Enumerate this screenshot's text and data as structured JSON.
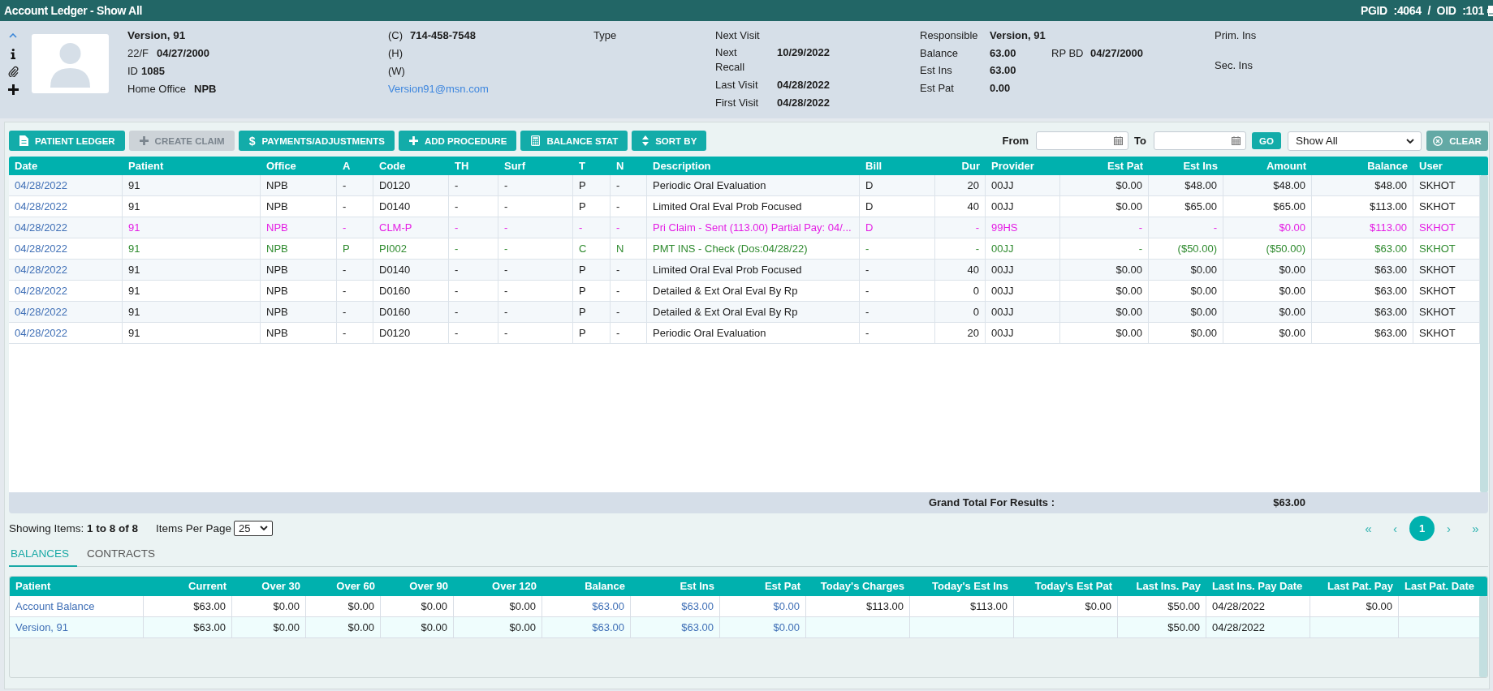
{
  "window": {
    "title": "Account Ledger - Show All",
    "ids": "PGID :4064 / OID :101"
  },
  "patient": {
    "name": "Version, 91",
    "age_sex": "22/F",
    "dob": "04/27/2000",
    "id_label": "ID",
    "id": "1085",
    "office_label": "Home Office",
    "office": "NPB"
  },
  "contact": {
    "phones": [
      {
        "label": "(C)",
        "value": "714-458-7548"
      },
      {
        "label": "(H)"
      },
      {
        "label": "(W)"
      }
    ],
    "email": "Version91@msn.com"
  },
  "type": {
    "label": "Type"
  },
  "visits": [
    {
      "label": "Next Visit"
    },
    {
      "label": "Next Recall",
      "value": "10/29/2022"
    },
    {
      "label": "Last Visit",
      "value": "04/28/2022"
    },
    {
      "label": "First Visit",
      "value": "04/28/2022"
    }
  ],
  "account": {
    "rows": [
      {
        "label": "Responsible",
        "value": "Version, 91"
      },
      {
        "label": "Balance",
        "value": "63.00"
      },
      {
        "label": "Est Ins",
        "value": "63.00"
      },
      {
        "label": "Est Pat",
        "value": "0.00"
      }
    ],
    "rp_bd": {
      "label": "RP BD",
      "value": "04/27/2000"
    }
  },
  "insurance": [
    {
      "label": "Prim. Ins"
    },
    {
      "label": "Sec. Ins"
    }
  ],
  "toolbar": {
    "buttons": [
      {
        "label": "PATIENT LEDGER",
        "disabled": false
      },
      {
        "label": "CREATE CLAIM",
        "disabled": true
      },
      {
        "label": "PAYMENTS/ADJUSTMENTS",
        "glyph": "$",
        "disabled": false
      },
      {
        "label": "ADD PROCEDURE",
        "disabled": false
      },
      {
        "label": "BALANCE STAT",
        "disabled": false
      },
      {
        "label": "SORT BY",
        "disabled": false
      }
    ],
    "filter": {
      "from_label": "From",
      "to_label": "To",
      "go": "GO",
      "view": "Show All",
      "clear": "CLEAR"
    }
  },
  "ledger": {
    "columns": [
      "Date",
      "Patient",
      "Office",
      "A",
      "Code",
      "TH",
      "Surf",
      "T",
      "N",
      "Description",
      "Bill",
      "Dur",
      "Provider",
      "Est Pat",
      "Est Ins",
      "Amount",
      "Balance",
      "User"
    ],
    "rows": [
      {
        "kind": "procedure",
        "cells": [
          "04/28/2022",
          "91",
          "NPB",
          "-",
          "D0120",
          "-",
          "-",
          "P",
          "-",
          "Periodic Oral Evaluation",
          "D",
          "20",
          "00JJ",
          "$0.00",
          "$48.00",
          "$48.00",
          "$48.00",
          "SKHOT"
        ]
      },
      {
        "kind": "procedure",
        "cells": [
          "04/28/2022",
          "91",
          "NPB",
          "-",
          "D0140",
          "-",
          "-",
          "P",
          "-",
          "Limited Oral Eval Prob Focused",
          "D",
          "40",
          "00JJ",
          "$0.00",
          "$65.00",
          "$65.00",
          "$113.00",
          "SKHOT"
        ]
      },
      {
        "kind": "claim",
        "cells": [
          "04/28/2022",
          "91",
          "NPB",
          "-",
          "CLM-P",
          "-",
          "-",
          "-",
          "-",
          "Pri Claim - Sent (113.00) Partial Pay: 04/...",
          "D",
          "-",
          "99HS",
          "-",
          "-",
          "$0.00",
          "$113.00",
          "SKHOT"
        ]
      },
      {
        "kind": "payment",
        "cells": [
          "04/28/2022",
          "91",
          "NPB",
          "P",
          "PI002",
          "-",
          "-",
          "C",
          "N",
          "PMT INS - Check (Dos:04/28/22)",
          "-",
          "-",
          "00JJ",
          "-",
          "($50.00)",
          "($50.00)",
          "$63.00",
          "SKHOT"
        ]
      },
      {
        "kind": "procedure",
        "cells": [
          "04/28/2022",
          "91",
          "NPB",
          "-",
          "D0140",
          "-",
          "-",
          "P",
          "-",
          "Limited Oral Eval Prob Focused",
          "-",
          "40",
          "00JJ",
          "$0.00",
          "$0.00",
          "$0.00",
          "$63.00",
          "SKHOT"
        ]
      },
      {
        "kind": "procedure",
        "cells": [
          "04/28/2022",
          "91",
          "NPB",
          "-",
          "D0160",
          "-",
          "-",
          "P",
          "-",
          "Detailed & Ext Oral Eval By Rp",
          "-",
          "0",
          "00JJ",
          "$0.00",
          "$0.00",
          "$0.00",
          "$63.00",
          "SKHOT"
        ]
      },
      {
        "kind": "procedure",
        "cells": [
          "04/28/2022",
          "91",
          "NPB",
          "-",
          "D0160",
          "-",
          "-",
          "P",
          "-",
          "Detailed & Ext Oral Eval By Rp",
          "-",
          "0",
          "00JJ",
          "$0.00",
          "$0.00",
          "$0.00",
          "$63.00",
          "SKHOT"
        ]
      },
      {
        "kind": "procedure",
        "cells": [
          "04/28/2022",
          "91",
          "NPB",
          "-",
          "D0120",
          "-",
          "-",
          "P",
          "-",
          "Periodic Oral Evaluation",
          "-",
          "20",
          "00JJ",
          "$0.00",
          "$0.00",
          "$0.00",
          "$63.00",
          "SKHOT"
        ]
      }
    ],
    "grand_total_label": "Grand Total For Results :",
    "grand_total": "$63.00"
  },
  "paging": {
    "showing": "Showing Items: **1 to 8 of 8**",
    "per_page_label": "Items Per Page",
    "per_page": "25",
    "first": "«",
    "prev": "‹",
    "pages": [
      {
        "label": "1",
        "selected": true
      }
    ],
    "next": "›",
    "last": "»"
  },
  "tabs": [
    {
      "label": "BALANCES",
      "selected": true
    },
    {
      "label": "CONTRACTS",
      "selected": false
    }
  ],
  "balances": {
    "columns": [
      "Patient",
      "Current",
      "Over 30",
      "Over 60",
      "Over 90",
      "Over 120",
      "Balance",
      "Est Ins",
      "Est Pat",
      "Today's Charges",
      "Today's Est Ins",
      "Today's Est Pat",
      "Last Ins. Pay",
      "Last Ins. Pay Date",
      "Last Pat. Pay",
      "Last Pat. Date"
    ],
    "rows": [
      {
        "cells": [
          "Account Balance",
          "$63.00",
          "$0.00",
          "$0.00",
          "$0.00",
          "$0.00",
          "$63.00",
          "$63.00",
          "$0.00",
          "$113.00",
          "$113.00",
          "$0.00",
          "$50.00",
          "04/28/2022",
          "$0.00",
          null
        ]
      },
      {
        "cells": [
          "Version, 91",
          "$63.00",
          "$0.00",
          "$0.00",
          "$0.00",
          "$0.00",
          "$63.00",
          "$63.00",
          "$0.00",
          null,
          null,
          null,
          "$50.00",
          "04/28/2022",
          null,
          null
        ]
      }
    ]
  }
}
